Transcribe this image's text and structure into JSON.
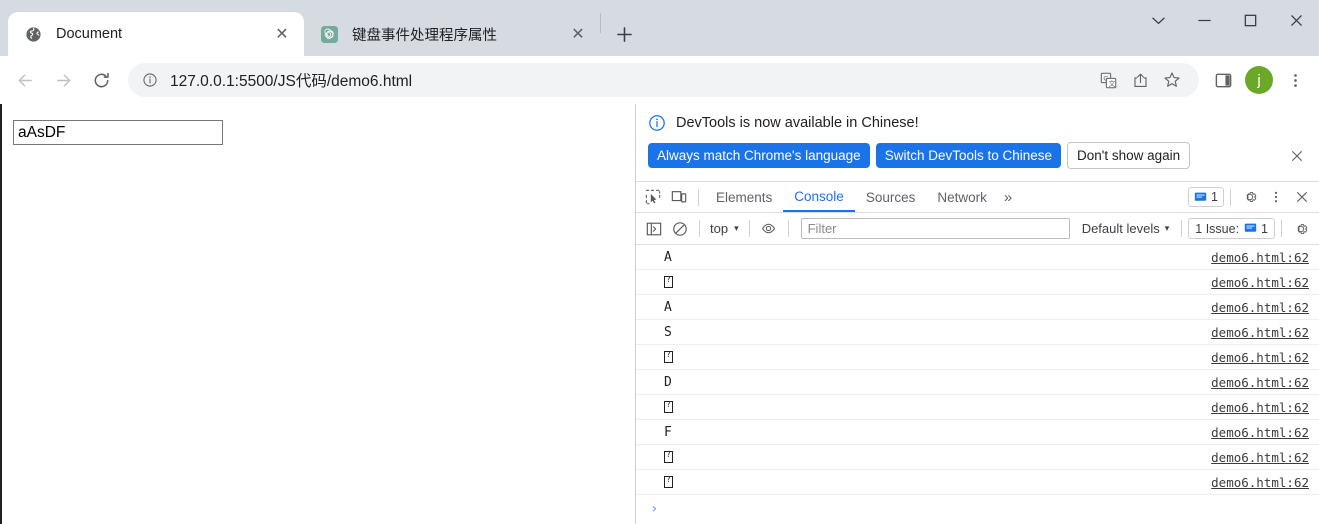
{
  "window": {
    "controls": [
      {
        "name": "tab-search-button",
        "glyph": "⌄"
      },
      {
        "name": "minimize-button",
        "glyph": "—"
      },
      {
        "name": "maximize-button",
        "glyph": "□"
      },
      {
        "name": "close-window-button",
        "glyph": "✕"
      }
    ]
  },
  "tabs": [
    {
      "title": "Document",
      "favicon": "globe-icon",
      "active": true,
      "close_glyph": "✕"
    },
    {
      "title": "键盘事件处理程序属性",
      "favicon": "chatgpt-icon",
      "active": false,
      "close_glyph": "✕"
    }
  ],
  "new_tab_label": "+",
  "toolbar": {
    "back_label": "←",
    "forward_label": "→",
    "reload_label": "⟳",
    "site_info_icon": "info-circle-icon",
    "url": "127.0.0.1:5500/JS代码/demo6.html",
    "translate_icon": "translate-icon",
    "share_icon": "share-icon",
    "bookmark_icon": "star-icon",
    "sidepanel_icon": "side-panel-icon",
    "profile_initial": "j",
    "menu_icon": "three-dots-vertical-icon"
  },
  "page": {
    "input_value": "aAsDF",
    "input_placeholder": ""
  },
  "devtools": {
    "notice": {
      "message": "DevTools is now available in Chinese!",
      "buttons": [
        {
          "label": "Always match Chrome's language",
          "style": "primary"
        },
        {
          "label": "Switch DevTools to Chinese",
          "style": "primary"
        },
        {
          "label": "Don't show again",
          "style": "ghost"
        }
      ],
      "close_glyph": "✕"
    },
    "panel_tabs": [
      {
        "label": "Elements",
        "active": false
      },
      {
        "label": "Console",
        "active": true
      },
      {
        "label": "Sources",
        "active": false
      },
      {
        "label": "Network",
        "active": false
      }
    ],
    "more_tabs_glyph": "»",
    "issue_count": "1",
    "settings_icon": "gear-icon",
    "dock_menu_icon": "three-dots-vertical-icon",
    "close_icon": "close-icon",
    "inspect_icon": "inspect-element-icon",
    "device_icon": "device-toolbar-icon",
    "filterbar": {
      "sidebar_icon": "console-sidebar-icon",
      "clear_icon": "clear-console-icon",
      "context": "top",
      "context_caret": "▾",
      "eye_icon": "live-expression-icon",
      "filter_placeholder": "Filter",
      "filter_value": "",
      "levels_label": "Default levels",
      "levels_caret": "▾",
      "issues_label": "1 Issue:",
      "issues_count": "1",
      "settings_icon": "gear-icon"
    },
    "console_logs": [
      {
        "message": "A",
        "tofu": false,
        "source": "demo6.html:62"
      },
      {
        "message": "",
        "tofu": true,
        "source": "demo6.html:62"
      },
      {
        "message": "A",
        "tofu": false,
        "source": "demo6.html:62"
      },
      {
        "message": "S",
        "tofu": false,
        "source": "demo6.html:62"
      },
      {
        "message": "",
        "tofu": true,
        "source": "demo6.html:62"
      },
      {
        "message": "D",
        "tofu": false,
        "source": "demo6.html:62"
      },
      {
        "message": "",
        "tofu": true,
        "source": "demo6.html:62"
      },
      {
        "message": "F",
        "tofu": false,
        "source": "demo6.html:62"
      },
      {
        "message": "",
        "tofu": true,
        "source": "demo6.html:62"
      },
      {
        "message": "",
        "tofu": true,
        "source": "demo6.html:62"
      }
    ],
    "prompt_caret": "›",
    "prompt_value": ""
  },
  "colors": {
    "chrome_tabstrip": "#d6dbe1",
    "accent_blue": "#1a73e8",
    "avatar_green": "#6ca828",
    "active_tab_underline": "#1a73e8"
  }
}
